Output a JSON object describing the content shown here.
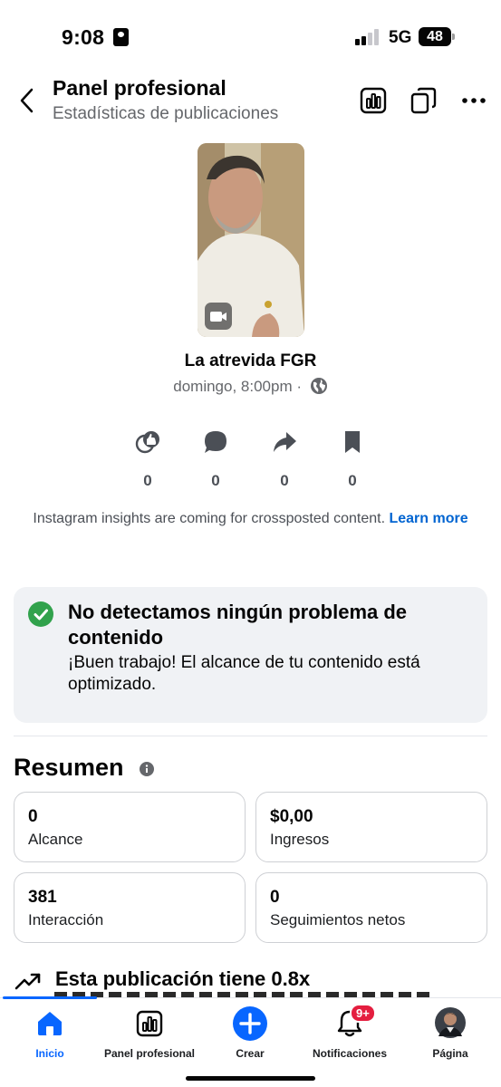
{
  "status_bar": {
    "time": "9:08",
    "network": "5G",
    "battery": "48"
  },
  "header": {
    "title": "Panel profesional",
    "subtitle": "Estadísticas de publicaciones"
  },
  "post": {
    "title": "La atrevida FGR",
    "meta": "domingo, 8:00pm ·"
  },
  "stats": [
    {
      "icon": "reaction-icon",
      "value": "0"
    },
    {
      "icon": "comment-icon",
      "value": "0"
    },
    {
      "icon": "share-icon",
      "value": "0"
    },
    {
      "icon": "bookmark-icon",
      "value": "0"
    }
  ],
  "instagram_note": {
    "text": "Instagram insights are coming for crossposted content.",
    "link": "Learn more"
  },
  "content_check": {
    "title": "No detectamos ningún problema de contenido",
    "body": "¡Buen trabajo! El alcance de tu contenido está optimizado."
  },
  "summary": {
    "title": "Resumen",
    "metrics": [
      {
        "value": "0",
        "label": "Alcance"
      },
      {
        "value": "$0,00",
        "label": "Ingresos"
      },
      {
        "value": "381",
        "label": "Interacción"
      },
      {
        "value": "0",
        "label": "Seguimientos netos"
      }
    ]
  },
  "trend": {
    "text": "Esta publicación tiene 0.8x"
  },
  "tabs": [
    {
      "label": "Inicio",
      "icon": "home-icon",
      "active": true
    },
    {
      "label": "Panel profesional",
      "icon": "dashboard-icon"
    },
    {
      "label": "Crear",
      "icon": "create-icon"
    },
    {
      "label": "Notificaciones",
      "icon": "bell-icon",
      "badge": "9+"
    },
    {
      "label": "Página",
      "icon": "avatar"
    }
  ],
  "colors": {
    "accent": "#0866ff",
    "link": "#0064d1",
    "success": "#31a24c",
    "card_bg": "#f0f2f5"
  }
}
